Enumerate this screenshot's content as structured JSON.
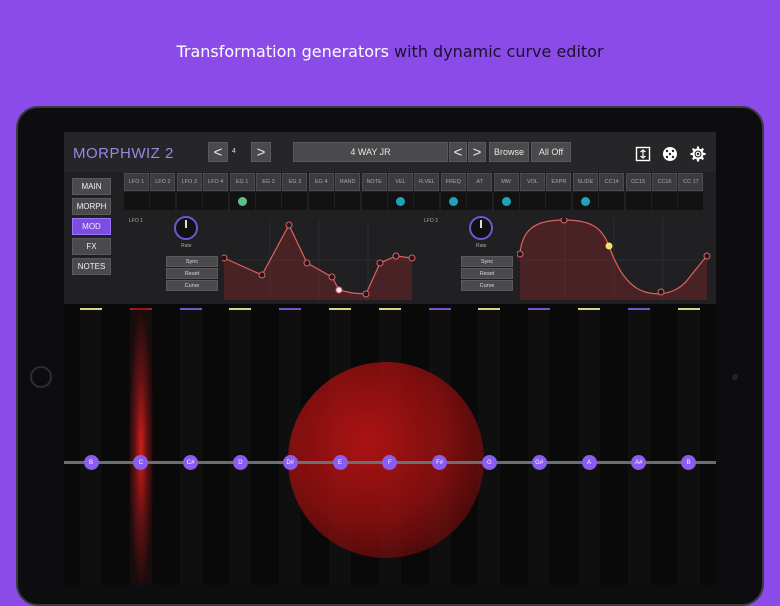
{
  "caption": {
    "part1": "Transformation generators",
    "part2": "with dynamic curve editor"
  },
  "app": {
    "title": "MORPHWIZ 2"
  },
  "toolbar": {
    "prev": "<",
    "next": ">",
    "number": "4",
    "preset_name": "4 WAY JR",
    "preset_prev": "<",
    "preset_next": ">",
    "browse": "Browse",
    "all_off": "All Off"
  },
  "icons": {
    "expand": "expand-icon",
    "dice": "dice-icon",
    "settings": "gear-icon"
  },
  "nav": [
    "MAIN",
    "MORPH",
    "MOD",
    "FX",
    "NOTES"
  ],
  "nav_active": "MOD",
  "sources": [
    {
      "label": "LFO 1",
      "dot": ""
    },
    {
      "label": "LFO 2",
      "dot": ""
    },
    {
      "label": "LFO 3",
      "dot": ""
    },
    {
      "label": "LFO 4",
      "dot": ""
    },
    {
      "label": "EG 1",
      "dot": "#5fbf8a"
    },
    {
      "label": "EG 2",
      "dot": ""
    },
    {
      "label": "EG 3",
      "dot": ""
    },
    {
      "label": "EG 4",
      "dot": ""
    },
    {
      "label": "RAND",
      "dot": ""
    },
    {
      "label": "NOTE",
      "dot": ""
    },
    {
      "label": "VEL",
      "dot": "#1ea3b8"
    },
    {
      "label": "R.VEL",
      "dot": ""
    },
    {
      "label": "FREQ",
      "dot": "#1ea3b8"
    },
    {
      "label": "AT",
      "dot": ""
    },
    {
      "label": "MW",
      "dot": "#1ea3b8"
    },
    {
      "label": "VOL",
      "dot": ""
    },
    {
      "label": "EXPR",
      "dot": ""
    },
    {
      "label": "SLIDE",
      "dot": "#1ea3b8"
    },
    {
      "label": "CC14",
      "dot": ""
    },
    {
      "label": "CC15",
      "dot": ""
    },
    {
      "label": "CC16",
      "dot": ""
    },
    {
      "label": "CC 17",
      "dot": ""
    }
  ],
  "lfo1": {
    "label": "LFO 1",
    "rate": "Rate",
    "sync": "Sync",
    "reset": "Reset",
    "curve": "Curve"
  },
  "lfo2": {
    "label": "LFO 2",
    "rate": "Rate",
    "sync": "Sync",
    "reset": "Reset",
    "curve": "Curve"
  },
  "notes": [
    "B",
    "C",
    "C#",
    "D",
    "D#",
    "E",
    "F",
    "F#",
    "G",
    "G#",
    "A",
    "A#",
    "B"
  ],
  "key_caps": [
    "#d9d48a",
    "#b02020",
    "#7a55c8",
    "#d9d48a",
    "#7a55c8",
    "#d9d48a",
    "#d9d48a",
    "#7a55c8",
    "#d9d48a",
    "#7a55c8",
    "#d9d48a",
    "#7a55c8",
    "#d9d48a"
  ],
  "colors": {
    "accent": "#8b5cf0",
    "curve": "#e06060",
    "background": "#8a4be8"
  }
}
